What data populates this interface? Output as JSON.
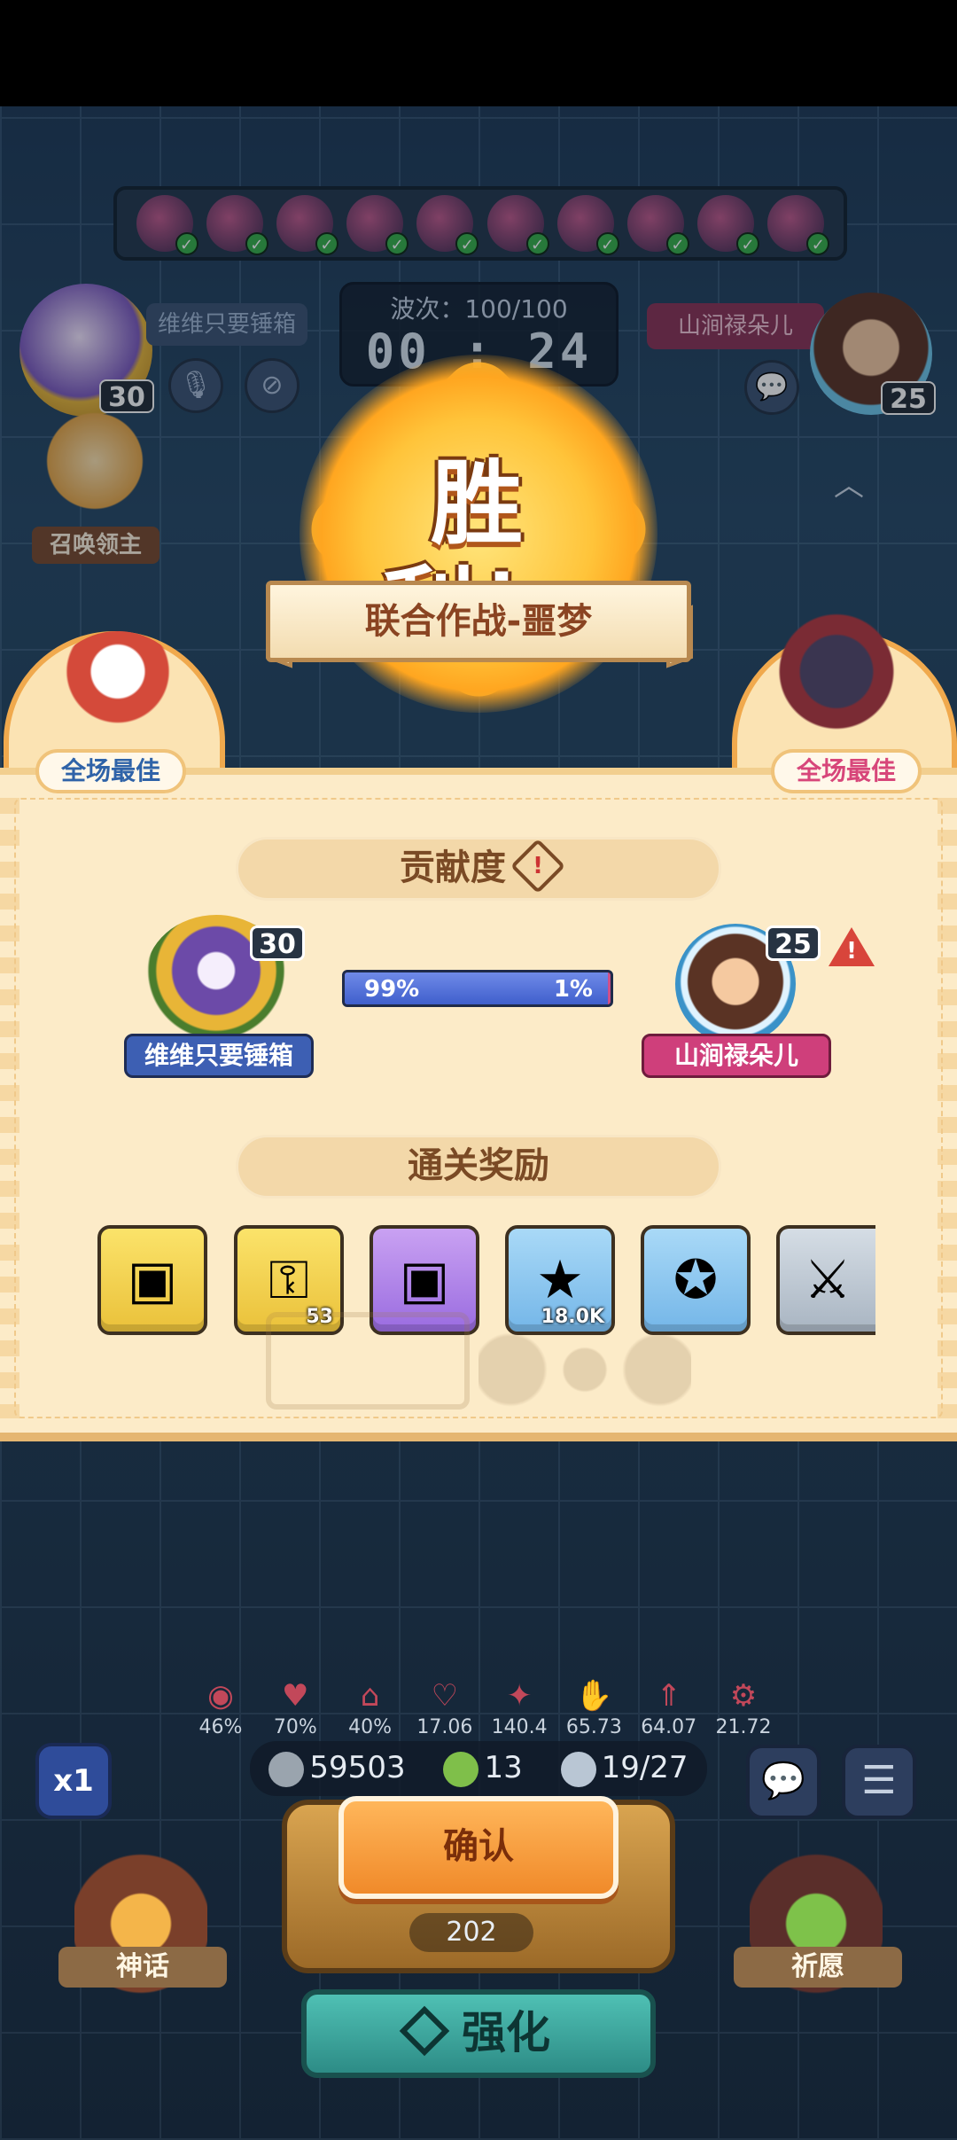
{
  "battle": {
    "wave_label": "波次：100/100",
    "timer": "00 : 24",
    "player_left": {
      "name": "维维只要锤箱",
      "level": "30"
    },
    "player_right": {
      "name": "山涧禄朵儿",
      "level": "25"
    },
    "summon_label": "召唤领主",
    "hero_count": 10
  },
  "result": {
    "title": "胜利！",
    "mode": "联合作战-噩梦",
    "mvp_left": "全场最佳",
    "mvp_right": "全场最佳"
  },
  "contribution": {
    "heading": "贡献度",
    "left_pct": "99%",
    "right_pct": "1%",
    "left_fraction": 0.99
  },
  "rewards": {
    "heading": "通关奖励",
    "items": [
      {
        "icon": "gold-chest-icon",
        "count": ""
      },
      {
        "icon": "gold-key-icon",
        "count": "53"
      },
      {
        "icon": "purple-chest-icon",
        "count": ""
      },
      {
        "icon": "star-coin-icon",
        "count": "18.0K"
      },
      {
        "icon": "blue-star-token-icon",
        "count": ""
      },
      {
        "icon": "sword-token-icon",
        "count": ""
      }
    ]
  },
  "stats": [
    {
      "icon": "attack-icon",
      "value": "46%"
    },
    {
      "icon": "heart-icon",
      "value": "70%"
    },
    {
      "icon": "house-icon",
      "value": "40%"
    },
    {
      "icon": "heal-icon",
      "value": "17.06"
    },
    {
      "icon": "crit-icon",
      "value": "140.4"
    },
    {
      "icon": "hands-icon",
      "value": "65.73"
    },
    {
      "icon": "boost-icon",
      "value": "64.07"
    },
    {
      "icon": "gear-icon",
      "value": "21.72"
    }
  ],
  "resources": {
    "silver": "59503",
    "clover": "13",
    "units": "19/27"
  },
  "controls": {
    "speed": "x1",
    "confirm": "确认",
    "cost": "202",
    "myth": "神话",
    "pray": "祈愿",
    "upgrade": "强化"
  },
  "colors": {
    "left_bar": "#3f5fcc",
    "right_bar": "#cf4f88",
    "panel": "#fcebc8"
  }
}
